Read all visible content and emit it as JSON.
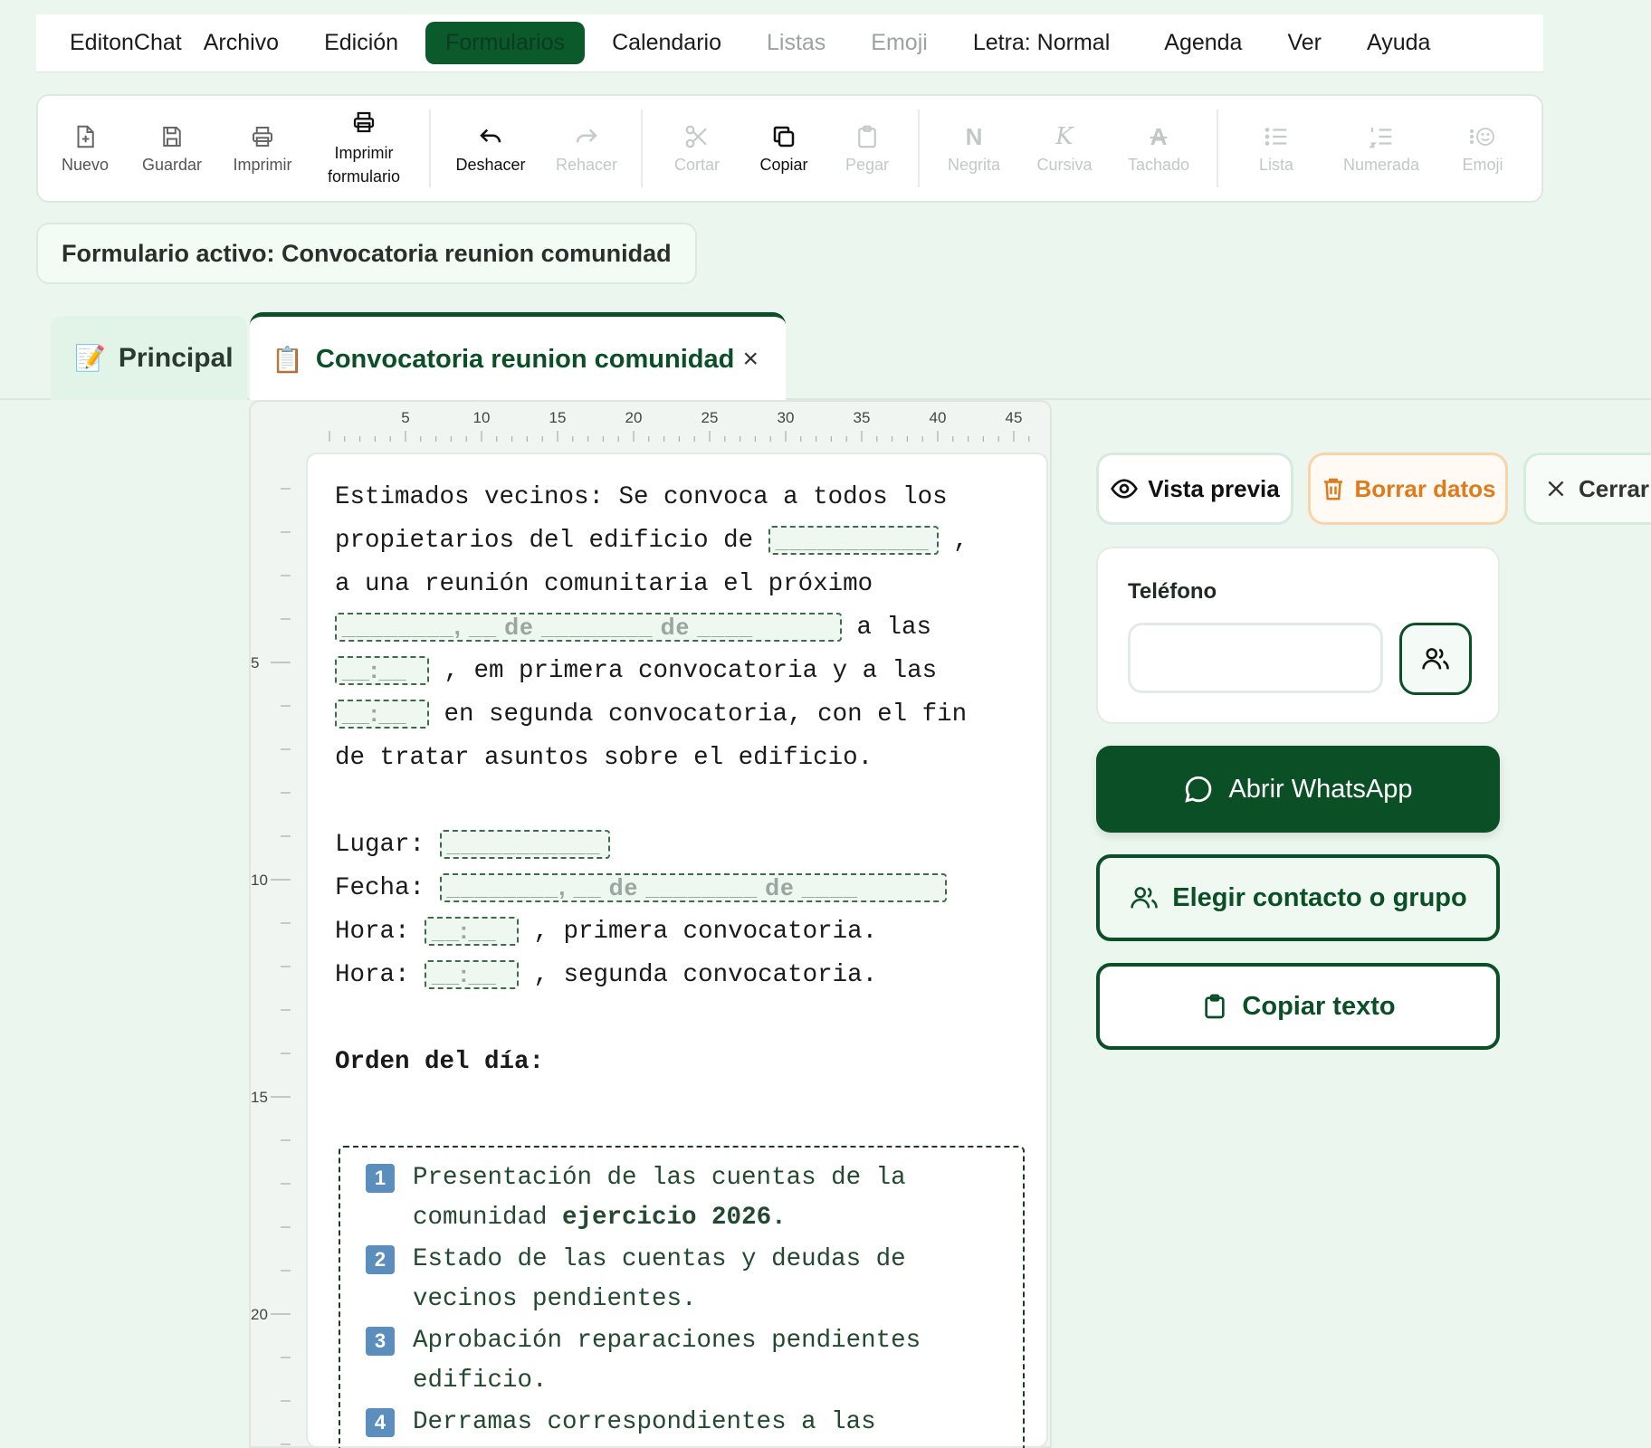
{
  "menubar": {
    "app_name": "EditonChat",
    "items": [
      {
        "label": "Archivo",
        "state": "normal"
      },
      {
        "label": "Edición",
        "state": "normal"
      },
      {
        "label": "Formularios",
        "state": "active"
      },
      {
        "label": "Calendario",
        "state": "normal"
      },
      {
        "label": "Listas",
        "state": "disabled"
      },
      {
        "label": "Emoji",
        "state": "disabled"
      },
      {
        "label": "Letra: Normal",
        "state": "normal"
      },
      {
        "label": "Agenda",
        "state": "normal"
      },
      {
        "label": "Ver",
        "state": "normal"
      },
      {
        "label": "Ayuda",
        "state": "normal"
      }
    ]
  },
  "toolbar": {
    "new_label": "Nuevo",
    "save_label": "Guardar",
    "print_label": "Imprimir",
    "print_form_line1": "Imprimir",
    "print_form_line2": "formulario",
    "undo_label": "Deshacer",
    "redo_label": "Rehacer",
    "cut_label": "Cortar",
    "copy_label": "Copiar",
    "paste_label": "Pegar",
    "bold_glyph": "N",
    "bold_label": "Negrita",
    "italic_glyph": "K",
    "italic_label": "Cursiva",
    "strike_glyph": "A",
    "strike_label": "Tachado",
    "list_label": "Lista",
    "numbered_label": "Numerada",
    "emoji_label": "Emoji"
  },
  "active_form_label": "Formulario activo: Convocatoria reunion comunidad",
  "tabs": {
    "principal": {
      "icon": "📝",
      "label": "Principal"
    },
    "form": {
      "icon": "📋",
      "label": "Convocatoria reunion comunidad",
      "close": "×"
    }
  },
  "ruler": {
    "horizontal": [
      "5",
      "10",
      "15",
      "20",
      "25",
      "30",
      "35",
      "40",
      "45"
    ],
    "vertical": [
      "5",
      "10",
      "15",
      "20"
    ]
  },
  "document": {
    "p1_l1": "Estimados vecinos: Se convoca a todos los",
    "p1_l2a": "propietarios del edificio de",
    "p1_l2_field": "___________",
    "p1_l2b": " ,",
    "p1_l3": "a una reunión comunitaria el próximo",
    "p1_l4_field": "________, __ de ________ de ____",
    "p1_l4b": " a las",
    "p1_l5_field": "__:__",
    "p1_l5b": " , em primera convocatoria y a las",
    "p1_l6_field": "__:__",
    "p1_l6b": " en segunda convocatoria, con el fin",
    "p1_l7": "de tratar asuntos sobre el edificio.",
    "lugar_label": "Lugar: ",
    "lugar_field": "___________",
    "fecha_label": "Fecha: ",
    "fecha_field": "________, __ de ________ de ____",
    "hora1_label": "Hora: ",
    "hora1_field": "__:__",
    "hora1_tail": " , primera convocatoria.",
    "hora2_label": "Hora: ",
    "hora2_field": "__:__",
    "hora2_tail": " , segunda convocatoria.",
    "orden_title": "Orden del día:",
    "order_items": [
      {
        "num": "1",
        "text_a": "Presentación de las cuentas de la",
        "text_b": "comunidad ",
        "text_bold": "ejercicio 2026."
      },
      {
        "num": "2",
        "text_a": "Estado de las cuentas y deudas de",
        "text_b": "vecinos pendientes."
      },
      {
        "num": "3",
        "text_a": "Aprobación reparaciones pendientes",
        "text_b": "edificio."
      },
      {
        "num": "4",
        "text_a": "Derramas correspondientes a las"
      }
    ]
  },
  "side": {
    "preview_label": "Vista previa",
    "clear_label": "Borrar datos",
    "close_label": "Cerrar",
    "phone_label": "Teléfono",
    "phone_value": "",
    "whatsapp_label": "Abrir WhatsApp",
    "choose_label": "Elegir contacto o grupo",
    "copy_text_label": "Copiar texto"
  }
}
